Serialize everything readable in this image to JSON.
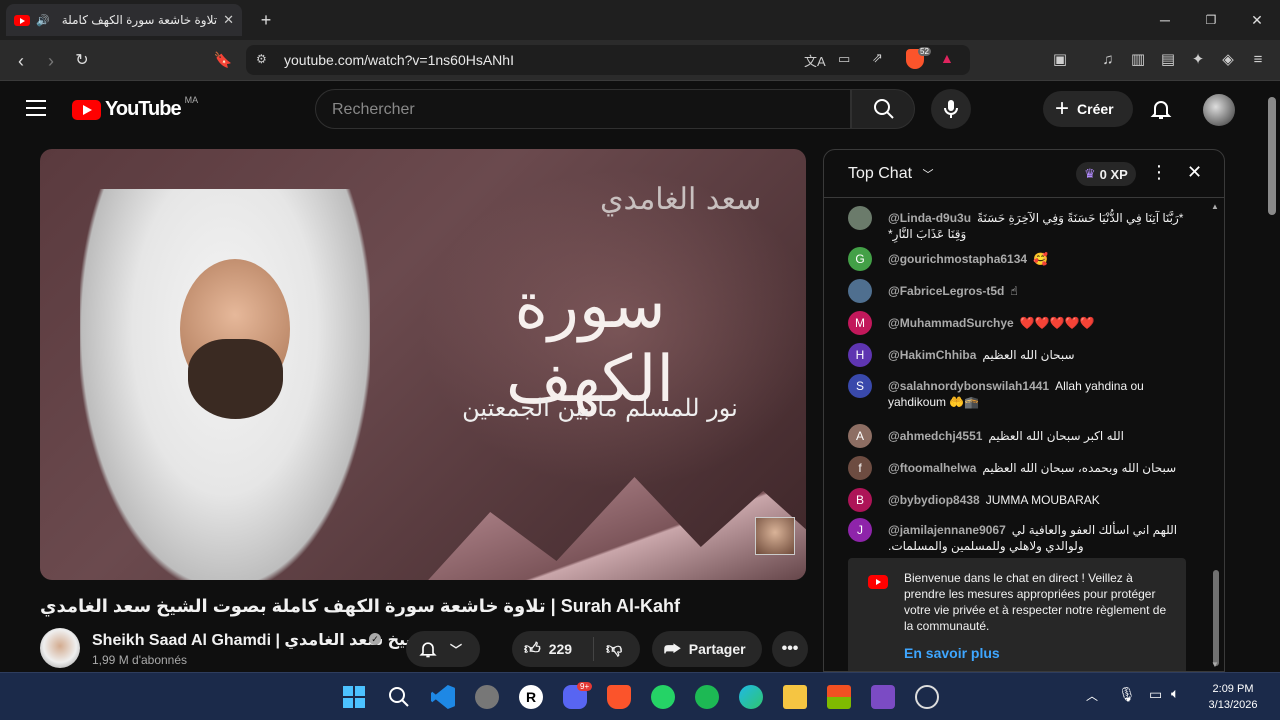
{
  "browser": {
    "tab_title": "تلاوة خاشعة سورة الكهف كاملة",
    "url": "youtube.com/watch?v=1ns60HsANhI",
    "extension_badge": "52"
  },
  "youtube": {
    "logo_text": "YouTube",
    "country_code": "MA",
    "search_placeholder": "Rechercher",
    "create_label": "Créer"
  },
  "video": {
    "overlay_top": "سعد الغامدي",
    "overlay_title": "سورة الكهف",
    "overlay_subtitle": "نور للمسلم ما بين الجمعتين",
    "title": "تلاوة خاشعة سورة الكهف كاملة بصوت الشيخ سعد الغامدي | Surah Al-Kahf",
    "channel_name": "Sheikh Saad Al Ghamdi | الشيخ سعد الغامدي",
    "subscribers": "1,99 M d'abonnés",
    "like_count": "229",
    "share_label": "Partager"
  },
  "chat": {
    "title": "Top Chat",
    "xp_label": "0 XP",
    "messages": [
      {
        "author": "@Linda-d9u3u",
        "text": "*رَبَّنَا آتِنَا فِي الدُّنْيَا حَسَنَةً وَفِي الآخِرَةِ حَسَنَةً وَقِنَا عَذَابَ النَّارِ*",
        "avatar_letter": "",
        "avatar_color": "#6b7b6b",
        "rtl": true
      },
      {
        "author": "@gourichmostapha6134",
        "text": "🥰",
        "avatar_letter": "G",
        "avatar_color": "#43a047",
        "rtl": false
      },
      {
        "author": "@FabriceLegros-t5d",
        "text": "☝",
        "avatar_letter": "",
        "avatar_color": "#4f6f8f",
        "rtl": false
      },
      {
        "author": "@MuhammadSurchye",
        "text": "❤️❤️❤️❤️❤️",
        "avatar_letter": "M",
        "avatar_color": "#c2185b",
        "rtl": false
      },
      {
        "author": "@HakimChhiba",
        "text": "سبحان الله العظيم",
        "avatar_letter": "H",
        "avatar_color": "#5e35b1",
        "rtl": true
      },
      {
        "author": "@salahnordybonswilah1441",
        "text": "Allah yahdina ou yahdikoum 🤲🕋",
        "avatar_letter": "S",
        "avatar_color": "#3949ab",
        "rtl": false
      },
      {
        "author": "@ahmedchj4551",
        "text": "الله اكبر سبحان الله العظيم",
        "avatar_letter": "A",
        "avatar_color": "#8d6e63",
        "rtl": true
      },
      {
        "author": "@ftoomalhelwa",
        "text": "سبحان الله وبحمده، سبحان الله العظيم",
        "avatar_letter": "f",
        "avatar_color": "#6d4c41",
        "rtl": true
      },
      {
        "author": "@bybydiop8438",
        "text": "JUMMA MOUBARAK",
        "avatar_letter": "B",
        "avatar_color": "#ad1457",
        "rtl": false
      },
      {
        "author": "@jamilajennane9067",
        "text": "اللهم اني اسألك العفو والعافية لي ولوالدي ولاهلي وللمسلمين والمسلمات.",
        "avatar_letter": "J",
        "avatar_color": "#8e24aa",
        "rtl": true
      }
    ],
    "welcome_text": "Bienvenue dans le chat en direct ! Veillez à prendre les mesures appropriées pour protéger votre vie privée et à respecter notre règlement de la communauté.",
    "welcome_link": "En savoir plus"
  },
  "taskbar": {
    "time": "2:09 PM",
    "date": "3/13/2026",
    "discord_badge": "9+"
  },
  "colors": {
    "brand_red": "#ff0000",
    "link_blue": "#3ea6ff",
    "bg": "#0f0f0f"
  }
}
